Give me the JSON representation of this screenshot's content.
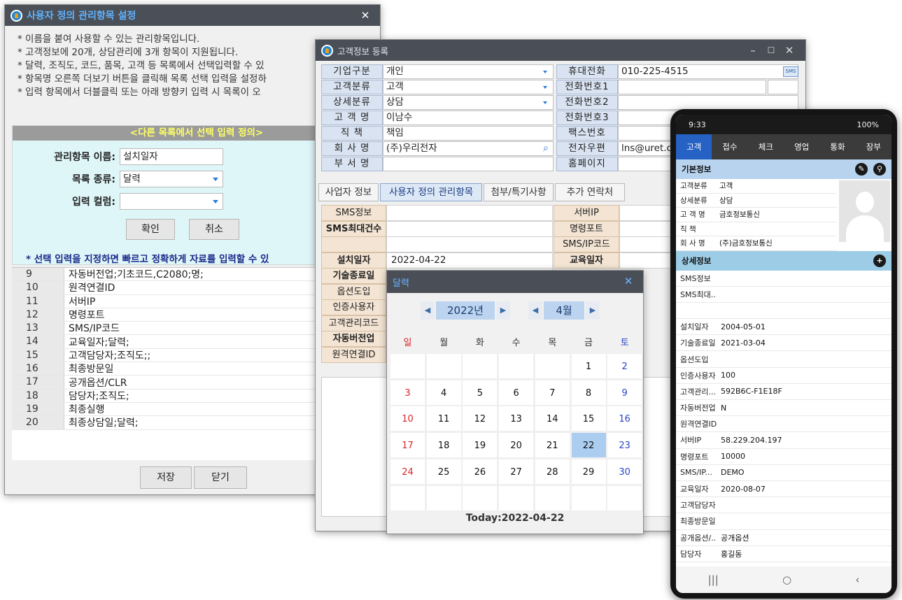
{
  "w1": {
    "title": "사용자 정의 관리항목 설정",
    "notes": [
      "* 이름을 붙여 사용할 수 있는 관리항목입니다.",
      "* 고객정보에 20개, 상담관리에 3개 항목이 지원됩니다.",
      "* 달력, 조직도, 코드, 품목, 고객 등 목록에서 선택입력할 수 있",
      "* 항목명 오른쪽 더보기 버튼을 클릭해 목록 선택 입력을 설정하",
      "* 입력 항목에서 더블클릭 또는 아래 방향키 입력 시 목록이 오"
    ],
    "def_header": "<다른 목록에서 선택 입력 정의>",
    "name_label": "관리항목 이름:",
    "name_value": "설치일자",
    "list_type_label": "목록 종류:",
    "list_type_value": "달력",
    "column_label": "입력 컬럼:",
    "column_value": "",
    "ok": "확인",
    "cancel": "취소",
    "note": "* 선택 입력을 지정하면 빠르고 정확하게 자료를 입력할 수 있",
    "rows": [
      {
        "num": "9",
        "text": "자동버전업;기초코드,C2080;명;"
      },
      {
        "num": "10",
        "text": "원격연결ID"
      },
      {
        "num": "11",
        "text": "서버IP"
      },
      {
        "num": "12",
        "text": "명령포트"
      },
      {
        "num": "13",
        "text": "SMS/IP코드"
      },
      {
        "num": "14",
        "text": "교육일자;달력;"
      },
      {
        "num": "15",
        "text": "고객담당자;조직도;;"
      },
      {
        "num": "16",
        "text": "최종방문일"
      },
      {
        "num": "17",
        "text": "공개옵션/CLR"
      },
      {
        "num": "18",
        "text": "담당자;조직도;"
      },
      {
        "num": "19",
        "text": "최종실행"
      },
      {
        "num": "20",
        "text": "최종상담일;달력;"
      }
    ],
    "save": "저장",
    "close": "닫기"
  },
  "w2": {
    "title": "고객정보 등록",
    "left_fields": [
      {
        "label": "기업구분",
        "value": "개인",
        "combo": true
      },
      {
        "label": "고객분류",
        "value": "고객",
        "combo": true
      },
      {
        "label": "상세분류",
        "value": "상담",
        "combo": true
      },
      {
        "label": "고 객 명",
        "value": "이남수",
        "combo": false
      },
      {
        "label": "직    책",
        "value": "책임",
        "combo": false
      },
      {
        "label": "회 사 명",
        "value": "(주)우리전자",
        "combo": false
      },
      {
        "label": "부 서 명",
        "value": "",
        "combo": false
      }
    ],
    "right_fields": [
      {
        "label": "휴대전화",
        "value": "010-225-4515"
      },
      {
        "label": "전화번호1",
        "value": ""
      },
      {
        "label": "전화번호2",
        "value": ""
      },
      {
        "label": "전화번호3",
        "value": ""
      },
      {
        "label": "팩스번호",
        "value": ""
      },
      {
        "label": "전자우편",
        "value": "lns@uret.co"
      },
      {
        "label": "홈페이지",
        "value": ""
      }
    ],
    "sms_badge": "SMS",
    "tabs": [
      "사업자 정보",
      "사용자 정의 관리항목",
      "첨부/특기사항",
      "추가 연락처"
    ],
    "custom_left": [
      {
        "label": "SMS정보",
        "value": "",
        "bold": false
      },
      {
        "label": "SMS최대건수",
        "value": "",
        "bold": true
      },
      {
        "label": "",
        "value": "",
        "bold": false
      },
      {
        "label": "설치일자",
        "value": "2022-04-22",
        "bold": true
      },
      {
        "label": "기술종료일",
        "value": "",
        "bold": true
      },
      {
        "label": "옵션도입",
        "value": "",
        "bold": false
      },
      {
        "label": "인증사용자",
        "value": "",
        "bold": false
      },
      {
        "label": "고객관리코드",
        "value": "",
        "bold": false
      },
      {
        "label": "자동버전업",
        "value": "",
        "bold": true
      },
      {
        "label": "원격연결ID",
        "value": "",
        "bold": false
      }
    ],
    "custom_right": [
      {
        "label": "서버IP",
        "bold": false
      },
      {
        "label": "명령포트",
        "bold": false
      },
      {
        "label": "SMS/IP코드",
        "bold": false
      },
      {
        "label": "교육일자",
        "bold": true
      }
    ]
  },
  "cal": {
    "title": "달력",
    "year": "2022년",
    "month": "4월",
    "dows": [
      "일",
      "월",
      "화",
      "수",
      "목",
      "금",
      "토"
    ],
    "weeks": [
      [
        "",
        "",
        "",
        "",
        "",
        "1",
        "2"
      ],
      [
        "3",
        "4",
        "5",
        "6",
        "7",
        "8",
        "9"
      ],
      [
        "10",
        "11",
        "12",
        "13",
        "14",
        "15",
        "16"
      ],
      [
        "17",
        "18",
        "19",
        "20",
        "21",
        "22",
        "23"
      ],
      [
        "24",
        "25",
        "26",
        "27",
        "28",
        "29",
        "30"
      ],
      [
        "",
        "",
        "",
        "",
        "",
        "",
        ""
      ]
    ],
    "selected": "22",
    "today": "Today:2022-04-22"
  },
  "phone": {
    "time": "9:33",
    "battery": "100%",
    "tabs": [
      "고객",
      "접수",
      "체크",
      "영업",
      "통화",
      "장부"
    ],
    "basic_title": "기본정보",
    "basic": [
      {
        "label": "고객분류",
        "value": "고객"
      },
      {
        "label": "상세분류",
        "value": "상담"
      },
      {
        "label": "고 객 명",
        "value": "금호정보통신"
      },
      {
        "label": "직    책",
        "value": ""
      },
      {
        "label": "회 사 명",
        "value": "(주)금호정보통신"
      }
    ],
    "detail_title": "상세정보",
    "detail": [
      {
        "label": "SMS정보",
        "value": ""
      },
      {
        "label": "SMS최대...",
        "value": ""
      },
      {
        "label": "",
        "value": ""
      },
      {
        "label": "설치일자",
        "value": "2004-05-01"
      },
      {
        "label": "기술종료일",
        "value": "2021-03-04"
      },
      {
        "label": "옵션도입",
        "value": ""
      },
      {
        "label": "인증사용자",
        "value": "100"
      },
      {
        "label": "고객관리...",
        "value": "592B6C-F1E18F"
      },
      {
        "label": "자동버전업",
        "value": "N"
      },
      {
        "label": "원격연결ID",
        "value": ""
      },
      {
        "label": "서버IP",
        "value": "58.229.204.197"
      },
      {
        "label": "명령포트",
        "value": "10000"
      },
      {
        "label": "SMS/IP...",
        "value": "DEMO"
      },
      {
        "label": "교육일자",
        "value": "2020-08-07"
      },
      {
        "label": "고객담당자",
        "value": ""
      },
      {
        "label": "최종방문일",
        "value": ""
      },
      {
        "label": "공개옵션/...",
        "value": "공개옵션"
      },
      {
        "label": "담당자",
        "value": "홍길동"
      }
    ]
  }
}
